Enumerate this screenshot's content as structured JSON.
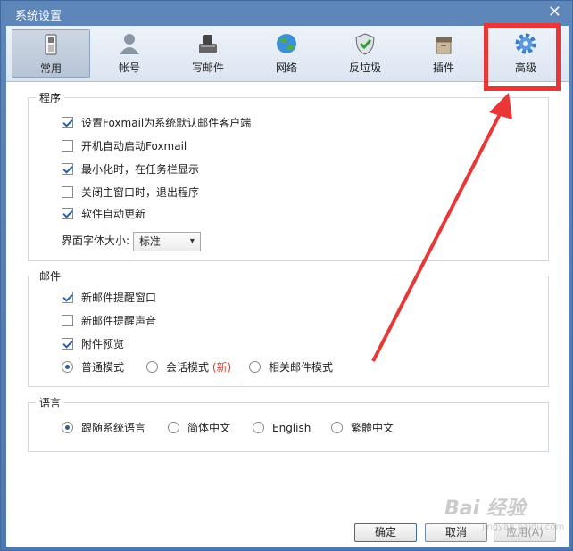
{
  "window": {
    "title": "系统设置",
    "close_glyph": "✕"
  },
  "toolbar": {
    "tabs": [
      {
        "label": "常用",
        "icon": "phone-settings-icon",
        "active": true
      },
      {
        "label": "帐号",
        "icon": "user-icon",
        "active": false
      },
      {
        "label": "写邮件",
        "icon": "write-mail-icon",
        "active": false
      },
      {
        "label": "网络",
        "icon": "globe-icon",
        "active": false
      },
      {
        "label": "反垃圾",
        "icon": "shield-icon",
        "active": false
      },
      {
        "label": "插件",
        "icon": "box-icon",
        "active": false
      },
      {
        "label": "高级",
        "icon": "gear-icon",
        "active": false
      }
    ]
  },
  "program_group": {
    "title": "程序",
    "options": [
      {
        "label": "设置Foxmail为系统默认邮件客户端",
        "checked": true
      },
      {
        "label": "开机自动启动Foxmail",
        "checked": false
      },
      {
        "label": "最小化时，在任务栏显示",
        "checked": true
      },
      {
        "label": "关闭主窗口时，退出程序",
        "checked": false
      },
      {
        "label": "软件自动更新",
        "checked": true
      }
    ],
    "font_size_label": "界面字体大小:",
    "font_size_value": "标准"
  },
  "mail_group": {
    "title": "邮件",
    "options": [
      {
        "label": "新邮件提醒窗口",
        "checked": true
      },
      {
        "label": "新邮件提醒声音",
        "checked": false
      },
      {
        "label": "附件预览",
        "checked": true
      }
    ],
    "modes": [
      {
        "label": "普通模式",
        "selected": true
      },
      {
        "label": "会话模式",
        "selected": false,
        "tag": "(新)"
      },
      {
        "label": "相关邮件模式",
        "selected": false
      }
    ]
  },
  "language_group": {
    "title": "语言",
    "options": [
      {
        "label": "跟随系统语言",
        "selected": true
      },
      {
        "label": "简体中文",
        "selected": false
      },
      {
        "label": "English",
        "selected": false
      },
      {
        "label": "繁體中文",
        "selected": false
      }
    ]
  },
  "buttons": {
    "ok": "确定",
    "cancel": "取消",
    "apply": "应用(A)"
  },
  "watermark": {
    "brand": "Bai 经验",
    "url": "jingyan.baidu.com"
  },
  "colors": {
    "annotation": "#e93737",
    "accent": "#2c5fa6",
    "title_bar": "#4e79b0"
  }
}
